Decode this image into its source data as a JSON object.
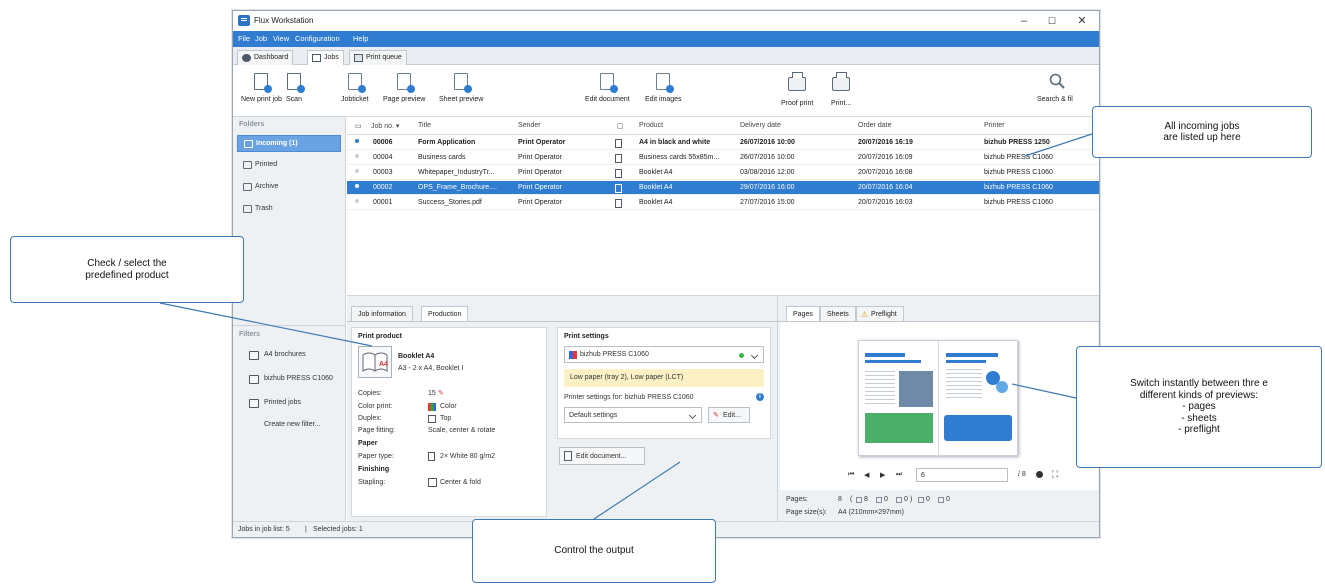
{
  "window": {
    "title": "Flux Workstation",
    "controls": {
      "minimize": "–",
      "maximize": "☐",
      "close": "✕"
    }
  },
  "menu": [
    "File",
    "Job",
    "View",
    "Configuration",
    "Help"
  ],
  "top_tabs": [
    {
      "label": "Dashboard",
      "icon": "dashboard-icon"
    },
    {
      "label": "Jobs",
      "icon": "jobs-icon"
    },
    {
      "label": "Print queue",
      "icon": "printer-icon"
    }
  ],
  "toolbar": {
    "new_print_job": "New print job",
    "scan": "Scan",
    "jobticket": "Jobticket",
    "page_preview": "Page preview",
    "sheet_preview": "Sheet preview",
    "edit_document": "Edit document",
    "edit_images": "Edit images",
    "proof_print": "Proof print",
    "print": "Print...",
    "search": "Search & fil"
  },
  "sidebar": {
    "folders_header": "Folders",
    "folders": [
      {
        "label": "Incoming (1)",
        "icon": "inbox-icon",
        "selected": true
      },
      {
        "label": "Printed",
        "icon": "printer-icon",
        "selected": false
      },
      {
        "label": "Archive",
        "icon": "archive-icon",
        "selected": false
      },
      {
        "label": "Trash",
        "icon": "trash-icon",
        "selected": false
      }
    ],
    "filters_header": "Filters",
    "filters": [
      "A4 brochures",
      "bizhub PRESS C1060",
      "Printed jobs"
    ],
    "create_filter": "Create new filter..."
  },
  "grid": {
    "headers": {
      "job_no": "Job no.",
      "title": "Title",
      "sender": "Sender",
      "product": "Product",
      "delivery": "Delivery date",
      "order": "Order date",
      "printer": "Printer"
    },
    "rows": [
      {
        "job_no": "00006",
        "title": "Form Application",
        "sender": "Print Operator",
        "product": "A4 in black and white",
        "delivery": "26/07/2016 10:00",
        "order": "20/07/2016 16:19",
        "printer": "bizhub PRESS 1250"
      },
      {
        "job_no": "00004",
        "title": "Business cards",
        "sender": "Print Operator",
        "product": "Business cards 55x85m...",
        "delivery": "26/07/2016 10:00",
        "order": "20/07/2016 16:09",
        "printer": "bizhub PRESS C1060"
      },
      {
        "job_no": "00003",
        "title": "Whitepaper_IndustryTr...",
        "sender": "Print Operator",
        "product": "Booklet A4",
        "delivery": "03/08/2016 12:00",
        "order": "20/07/2016 16:08",
        "printer": "bizhub PRESS C1060"
      },
      {
        "job_no": "00002",
        "title": "OPS_Frame_Brochure....",
        "sender": "Print Operator",
        "product": "Booklet A4",
        "delivery": "29/07/2016 16:00",
        "order": "20/07/2016 16:04",
        "printer": "bizhub PRESS C1060"
      },
      {
        "job_no": "00001",
        "title": "Success_Stories.pdf",
        "sender": "Print Operator",
        "product": "Booklet A4",
        "delivery": "27/07/2016 15:00",
        "order": "20/07/2016 16:03",
        "printer": "bizhub PRESS C1060"
      }
    ]
  },
  "job_tabs": {
    "info": "Job information",
    "production": "Production"
  },
  "print_product": {
    "header": "Print product",
    "name": "Booklet A4",
    "desc": "A3 - 2 x A4, Booklet I",
    "thumb_label": "A4",
    "copies_label": "Copies:",
    "copies": "15",
    "color_label": "Color print:",
    "color": "Color",
    "duplex_label": "Duplex:",
    "duplex": "Top",
    "fitting_label": "Page fitting:",
    "fitting": "Scale, center & rotate",
    "paper_header": "Paper",
    "paper_type_label": "Paper type:",
    "paper_type": "2× White 80 g/m2",
    "finishing_header": "Finishing",
    "stapling_label": "Stapling:",
    "stapling": "Center & fold"
  },
  "print_settings": {
    "header": "Print settings",
    "printer": "bizhub PRESS C1060",
    "warning": "Low paper (tray 2), Low paper (LCT)",
    "settings_for": "Printer settings for: bizhub PRESS C1060",
    "settings_value": "Default settings",
    "edit": "Edit...",
    "edit_document": "Edit document..."
  },
  "preview": {
    "tabs": [
      "Pages",
      "Sheets",
      "Preflight"
    ],
    "page_input": "6",
    "page_total": "/ 8",
    "pages_label": "Pages:",
    "pages_value": "8",
    "counts": [
      "8",
      "0",
      "0",
      "0",
      "0"
    ],
    "size_label": "Page size(s):",
    "size_value": "A4 (210mm×297mm)"
  },
  "status": {
    "jobs": "Jobs in job list: 5",
    "selected": "Selected jobs: 1"
  },
  "callouts": {
    "incoming": "All incoming jobs\nare listed up here",
    "product": "Check / select the\npredefined product",
    "previews": "Switch instantly between thre e\ndifferent kinds of previews:\n- pages\n- sheets\n- preflight",
    "output": "Control the output"
  },
  "colors": {
    "accent": "#2f7cd1",
    "callout_border": "#3f79b5",
    "warning_bg": "#fcf1c4"
  }
}
